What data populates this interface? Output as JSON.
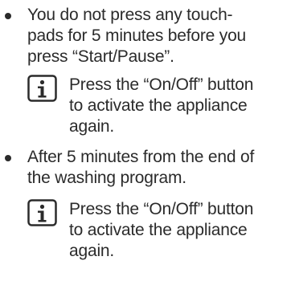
{
  "items": [
    {
      "text": "You do not press any touch-\npads for 5 minutes before you\npress “Start/Pause”.",
      "note": {
        "icon": "info-icon",
        "text": "Press the “On/Off” button\nto activate the appliance\nagain."
      }
    },
    {
      "text": "After 5 minutes from the end of\nthe washing program.",
      "note": {
        "icon": "info-icon",
        "text": "Press the “On/Off” button\nto activate the appliance\nagain."
      }
    }
  ]
}
